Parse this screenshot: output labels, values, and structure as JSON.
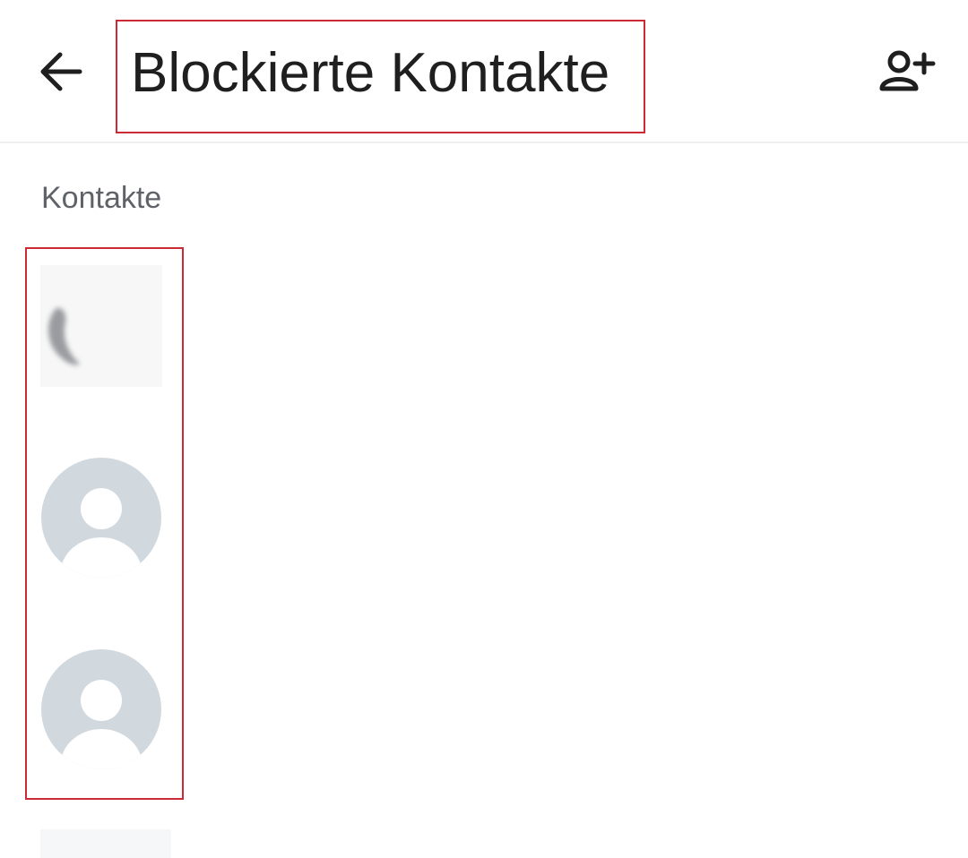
{
  "header": {
    "title": "Blockierte Kontakte",
    "back_icon": "arrow-left-icon",
    "add_icon": "person-add-icon"
  },
  "section": {
    "label": "Kontakte"
  },
  "contacts": [
    {
      "avatar": "photo"
    },
    {
      "avatar": "default-person-icon"
    },
    {
      "avatar": "default-person-icon"
    }
  ],
  "colors": {
    "highlight": "#cc2b36",
    "avatar_bg": "#d1d8de",
    "text_primary": "#1f1f1f",
    "text_secondary": "#5f6368"
  }
}
